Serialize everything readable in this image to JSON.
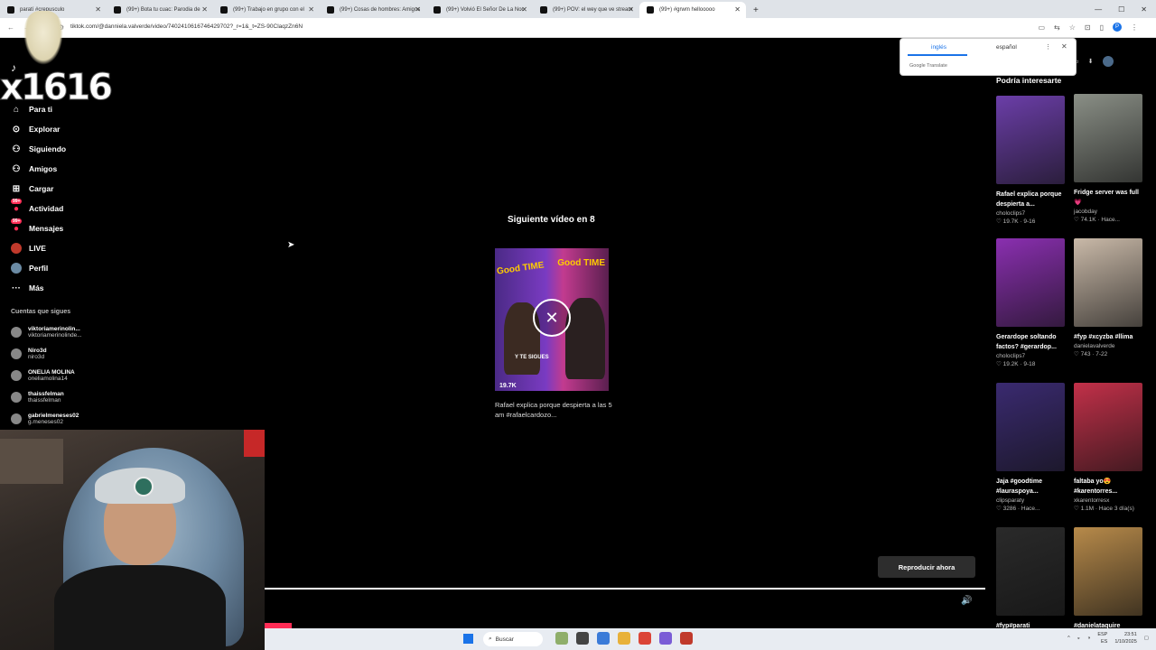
{
  "browser": {
    "tabs": [
      {
        "title": "paratí #crepusculo"
      },
      {
        "title": "(99+) Bota tu cuac: Parodia de"
      },
      {
        "title": "(99+) Trabajo en grupo con el"
      },
      {
        "title": "(99+) Cosas de hombres: Amigos"
      },
      {
        "title": "(99+) Volvió El Señor De La Noc"
      },
      {
        "title": "(99+) POV: el wey que ve stream"
      },
      {
        "title": "(99+) #grwm hellooooo",
        "active": true
      }
    ],
    "new_tab": "+",
    "url": "tiktok.com/@danniela.valverde/video/7402410616746429702?_r=1&_t=ZS-90ClaqzZn6N",
    "profile_letter": "P"
  },
  "translate_popup": {
    "tab_source": "inglés",
    "tab_target": "español",
    "brand": "Google Translate"
  },
  "overlay": {
    "stream_number": "x1616"
  },
  "sidebar": {
    "items": [
      {
        "label": "Para ti",
        "icon": "home-icon",
        "glyph": "⌂"
      },
      {
        "label": "Explorar",
        "icon": "compass-icon",
        "glyph": "⊙"
      },
      {
        "label": "Siguiendo",
        "icon": "following-icon",
        "glyph": "⚇"
      },
      {
        "label": "Amigos",
        "icon": "friends-icon",
        "glyph": "⚇"
      },
      {
        "label": "Cargar",
        "icon": "upload-icon",
        "glyph": "⊞"
      },
      {
        "label": "Actividad",
        "icon": "activity-icon",
        "glyph": "●",
        "badge": "99+"
      },
      {
        "label": "Mensajes",
        "icon": "messages-icon",
        "glyph": "●",
        "badge": "99+"
      },
      {
        "label": "LIVE",
        "icon": "live-icon"
      },
      {
        "label": "Perfil",
        "icon": "profile-icon"
      },
      {
        "label": "Más",
        "icon": "more-icon",
        "glyph": "···"
      }
    ],
    "following_title": "Cuentas que sigues",
    "following": [
      {
        "name": "viktoriamerinolin...",
        "handle": "viktoriamerinolinde..."
      },
      {
        "name": "Niro3d",
        "handle": "niro3d"
      },
      {
        "name": "ONELIA MOLINA",
        "handle": "oneliamolina14"
      },
      {
        "name": "thaissfelman",
        "handle": "thaissfelman"
      },
      {
        "name": "gabrielmeneses02",
        "handle": "g.meneses02"
      }
    ]
  },
  "player": {
    "next_title": "Siguiente vídeo en 8",
    "next_thumb_top_left": "Good TIME",
    "next_thumb_top_right": "Good TIME",
    "next_thumb_caption": "Y TE SIGUES",
    "next_thumb_likes": "19.7K",
    "next_description": "Rafael explica porque despierta a las 5 am #rafaelcardozo...",
    "play_now": "Reproducir ahora",
    "cancel_glyph": "✕",
    "volume_glyph": "🔊"
  },
  "recommendations": {
    "title": "Podría interesarte",
    "cards": [
      {
        "title": "Rafael explica porque despierta a...",
        "author": "choloclips7",
        "meta": "♡ 19.7K · 9-16",
        "color": "#6b3ea8"
      },
      {
        "title": "Fridge server was full 💗",
        "author": "jacobday",
        "meta": "♡ 74.1K · Hace...",
        "color": "#8a8f86"
      },
      {
        "title": "Gerardope soltando factos? #gerardop...",
        "author": "choloclips7",
        "meta": "♡ 19.2K · 9-18",
        "color": "#8a2fb0"
      },
      {
        "title": "#fyp #xcyzba #llima",
        "author": "danielavalverde",
        "meta": "♡ 743 · 7-22",
        "color": "#c9b9a8"
      },
      {
        "title": "Jaja #goodtime #lauraspoya...",
        "author": "clipsparaty",
        "meta": "♡ 3286 · Hace...",
        "color": "#3a2a70"
      },
      {
        "title": "faltaba yo😍 #karentorres...",
        "author": "xkarentorresx",
        "meta": "♡ 1.1M · Hace 3 día(s)",
        "color": "#c23049"
      },
      {
        "title": "#fyp#parati",
        "author": "",
        "meta": "",
        "color": "#2a2a2a"
      },
      {
        "title": "#danielataquire",
        "author": "",
        "meta": "",
        "color": "#b78a4a"
      }
    ]
  },
  "taskbar": {
    "search_label": "Buscar",
    "lang": "ESP",
    "lang_sub": "ES",
    "time": "23:51",
    "date": "1/10/2025"
  }
}
